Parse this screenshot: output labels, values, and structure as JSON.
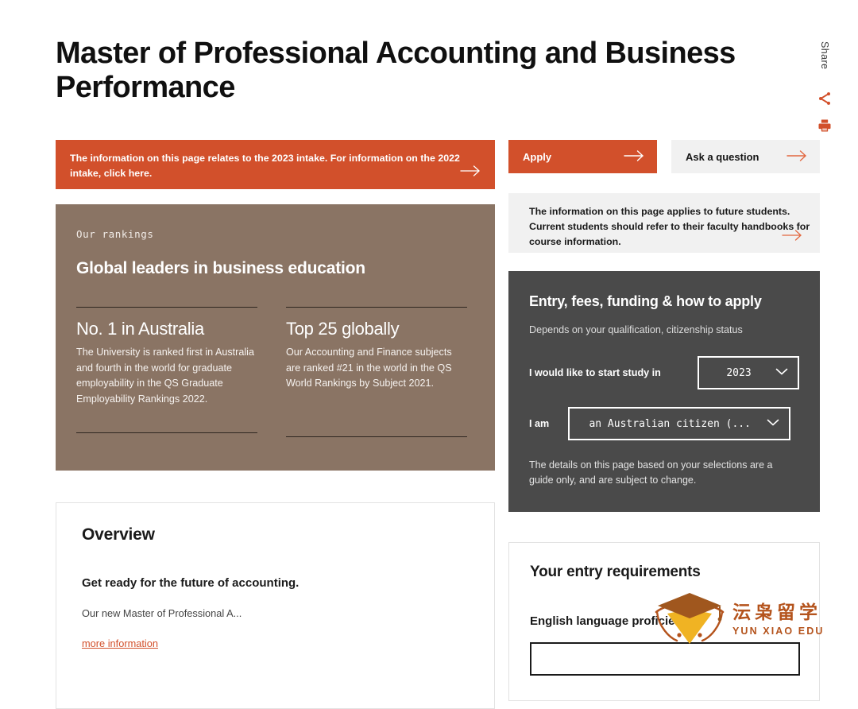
{
  "page": {
    "title": "Master of Professional Accounting and Business Performance"
  },
  "share_rail": {
    "label": "Share",
    "share_icon": "share-icon",
    "print_icon": "printer-icon"
  },
  "alert": {
    "text": "The information on this page relates to the 2023 intake. For information on the 2022 intake, click here.",
    "arrow_icon": "arrow-right-icon"
  },
  "rankings": {
    "eyebrow": "Our rankings",
    "heading": "Global leaders in business education",
    "items": [
      {
        "title": "No. 1 in Australia",
        "body": "The University is ranked first in Australia and fourth in the world for graduate employability in the QS Graduate Employability Rankings 2022."
      },
      {
        "title": "Top 25 globally",
        "body": "Our Accounting and Finance subjects are ranked #21 in the world in the QS World Rankings by Subject 2021."
      }
    ]
  },
  "overview": {
    "title": "Overview",
    "subtitle": "Get ready for the future of accounting.",
    "body": "Our new Master of Professional A...",
    "link": "more information"
  },
  "actions": {
    "apply_label": "Apply",
    "ask_label": "Ask a question",
    "arrow_icon": "arrow-right-icon"
  },
  "future_note": {
    "text": "The information on this page applies to future students. Current students should refer to their faculty handbooks for course information.",
    "arrow_icon": "arrow-right-icon"
  },
  "entry_panel": {
    "title": "Entry, fees, funding & how to apply",
    "subtitle": "Depends on your qualification, citizenship status",
    "year_label": "I would like to start study in",
    "year_value": "2023",
    "status_label": "I am",
    "status_value": "an Australian citizen (...",
    "chevron_icon": "chevron-down-icon",
    "footnote": "The details on this page based on your selections are a guide only, and are subject to change."
  },
  "entry_requirements": {
    "title": "Your entry requirements",
    "subtitle": "English language proficiency"
  },
  "watermark": {
    "cn": "沄枭留学",
    "en": "YUN XIAO EDU",
    "logo_icon": "graduation-cap-icon"
  },
  "colors": {
    "accent_orange": "#d2502b",
    "taupe": "#8a7464",
    "dark_panel": "#4a4a4a",
    "light_grey": "#f1f1f1",
    "watermark_brown": "#b4531c"
  }
}
